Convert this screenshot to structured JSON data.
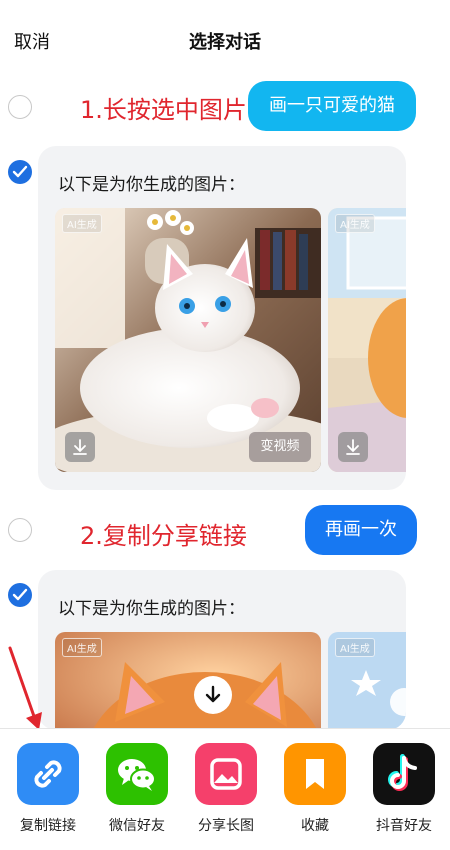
{
  "header": {
    "cancel_label": "取消",
    "title": "选择对话"
  },
  "annotations": {
    "step1": "1.长按选中图片",
    "step2": "2.复制分享链接"
  },
  "messages": {
    "user1": "画一只可爱的猫",
    "bot1": {
      "text": "以下是为你生成的图片：",
      "ai_tag_1": "AI生成",
      "ai_tag_2": "AI生成",
      "video_label": "变视频"
    },
    "user2": "再画一次",
    "bot2": {
      "text": "以下是为你生成的图片：",
      "ai_tag_1": "AI生成",
      "ai_tag_2": "AI生成"
    }
  },
  "share": {
    "items": [
      {
        "label": "复制链接",
        "icon": "link-icon",
        "color": "#2f8cf5"
      },
      {
        "label": "微信好友",
        "icon": "wechat-icon",
        "color": "#2dc100"
      },
      {
        "label": "分享长图",
        "icon": "image-icon",
        "color": "#f5406b"
      },
      {
        "label": "收藏",
        "icon": "bookmark-icon",
        "color": "#ff9500"
      },
      {
        "label": "抖音好友",
        "icon": "douyin-icon",
        "color": "#111111"
      }
    ]
  },
  "colors": {
    "accent_blue": "#1778f2",
    "annotation_red": "#e0262e",
    "bubble_cyan": "#12b6f0"
  }
}
